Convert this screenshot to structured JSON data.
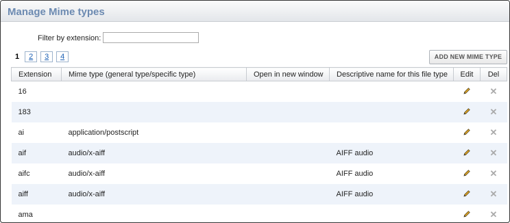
{
  "header": {
    "title": "Manage Mime types"
  },
  "filter": {
    "label": "Filter by extension:",
    "value": ""
  },
  "pagination": {
    "current": "1",
    "pages": [
      "2",
      "3",
      "4"
    ]
  },
  "toolbar": {
    "add_label": "ADD NEW MIME TYPE"
  },
  "table": {
    "columns": [
      "Extension",
      "Mime type (general type/specific type)",
      "Open in new window",
      "Descriptive name for this file type",
      "Edit",
      "Del"
    ],
    "rows": [
      {
        "extension": "16",
        "mime": "",
        "open_new": "",
        "description": ""
      },
      {
        "extension": "183",
        "mime": "",
        "open_new": "",
        "description": ""
      },
      {
        "extension": "ai",
        "mime": "application/postscript",
        "open_new": "",
        "description": ""
      },
      {
        "extension": "aif",
        "mime": "audio/x-aiff",
        "open_new": "",
        "description": "AIFF audio"
      },
      {
        "extension": "aifc",
        "mime": "audio/x-aiff",
        "open_new": "",
        "description": "AIFF audio"
      },
      {
        "extension": "aiff",
        "mime": "audio/x-aiff",
        "open_new": "",
        "description": "AIFF audio"
      },
      {
        "extension": "ama",
        "mime": "",
        "open_new": "",
        "description": ""
      }
    ]
  },
  "icons": {
    "edit": "pencil-icon",
    "delete": "close-icon"
  }
}
